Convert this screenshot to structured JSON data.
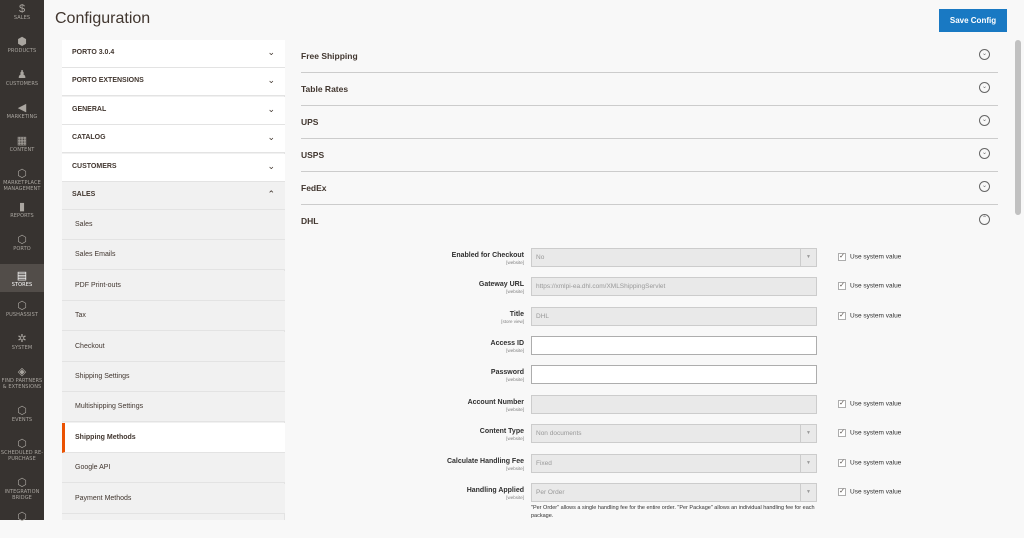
{
  "admin_nav": [
    {
      "icon": "$",
      "label": "SALES"
    },
    {
      "icon": "⬢",
      "label": "PRODUCTS"
    },
    {
      "icon": "♟",
      "label": "CUSTOMERS"
    },
    {
      "icon": "◀",
      "label": "MARKETING"
    },
    {
      "icon": "▦",
      "label": "CONTENT"
    },
    {
      "icon": "⬡",
      "label": "MARKETPLACE MANAGEMENT"
    },
    {
      "icon": "▮",
      "label": "REPORTS"
    },
    {
      "icon": "⬡",
      "label": "PORTO"
    },
    {
      "icon": "▤",
      "label": "STORES",
      "active": true
    },
    {
      "icon": "⬡",
      "label": "PUSHASSIST"
    },
    {
      "icon": "✲",
      "label": "SYSTEM"
    },
    {
      "icon": "◈",
      "label": "FIND PARTNERS & EXTENSIONS"
    },
    {
      "icon": "⬡",
      "label": "EVENTS"
    },
    {
      "icon": "⬡",
      "label": "SCHEDULED RE-PURCHASE"
    },
    {
      "icon": "⬡",
      "label": "INTEGRATION BRIDGE"
    },
    {
      "icon": "⬡",
      "label": ""
    }
  ],
  "header": {
    "title": "Configuration",
    "save_label": "Save Config"
  },
  "sidebar": {
    "tabs": [
      "PORTO 3.0.4",
      "PORTO EXTENSIONS",
      "GENERAL",
      "CATALOG",
      "CUSTOMERS",
      "SALES"
    ],
    "chevron_down": "⌄",
    "chevron_up": "⌃",
    "sales_items": [
      "Sales",
      "Sales Emails",
      "PDF Print-outs",
      "Tax",
      "Checkout",
      "Shipping Settings",
      "Multishipping Settings",
      "Shipping Methods",
      "Google API",
      "Payment Methods"
    ],
    "active_item": "Shipping Methods"
  },
  "sections": [
    {
      "title": "Free Shipping",
      "icon": "⌄"
    },
    {
      "title": "Table Rates",
      "icon": "⌄"
    },
    {
      "title": "UPS",
      "icon": "⌄"
    },
    {
      "title": "USPS",
      "icon": "⌄"
    },
    {
      "title": "FedEx",
      "icon": "⌄"
    },
    {
      "title": "DHL",
      "icon": "⌃"
    }
  ],
  "dhl_fields": [
    {
      "label": "Enabled for Checkout",
      "scope": "[website]",
      "value": "No",
      "type": "select",
      "system": true
    },
    {
      "label": "Gateway URL",
      "scope": "[website]",
      "value": "https://xmlpi-ea.dhl.com/XMLShippingServlet",
      "type": "text",
      "system": true
    },
    {
      "label": "Title",
      "scope": "[store view]",
      "value": "DHL",
      "type": "text",
      "system": true
    },
    {
      "label": "Access ID",
      "scope": "[website]",
      "value": "",
      "type": "input",
      "system": false
    },
    {
      "label": "Password",
      "scope": "[website]",
      "value": "",
      "type": "input",
      "system": false
    },
    {
      "label": "Account Number",
      "scope": "[website]",
      "value": "",
      "type": "text",
      "system": true
    },
    {
      "label": "Content Type",
      "scope": "[website]",
      "value": "Non documents",
      "type": "select",
      "system": true
    },
    {
      "label": "Calculate Handling Fee",
      "scope": "[website]",
      "value": "Fixed",
      "type": "select",
      "system": true
    },
    {
      "label": "Handling Applied",
      "scope": "[website]",
      "value": "Per Order",
      "type": "select",
      "system": true
    }
  ],
  "use_system_value": "Use system value",
  "handling_note": "\"Per Order\" allows a single handling fee for the entire order. \"Per Package\" allows an individual handling fee for each package.",
  "colors": {
    "nav_bg": "#373330",
    "accent": "#eb5202",
    "primary_button": "#1979c3"
  }
}
